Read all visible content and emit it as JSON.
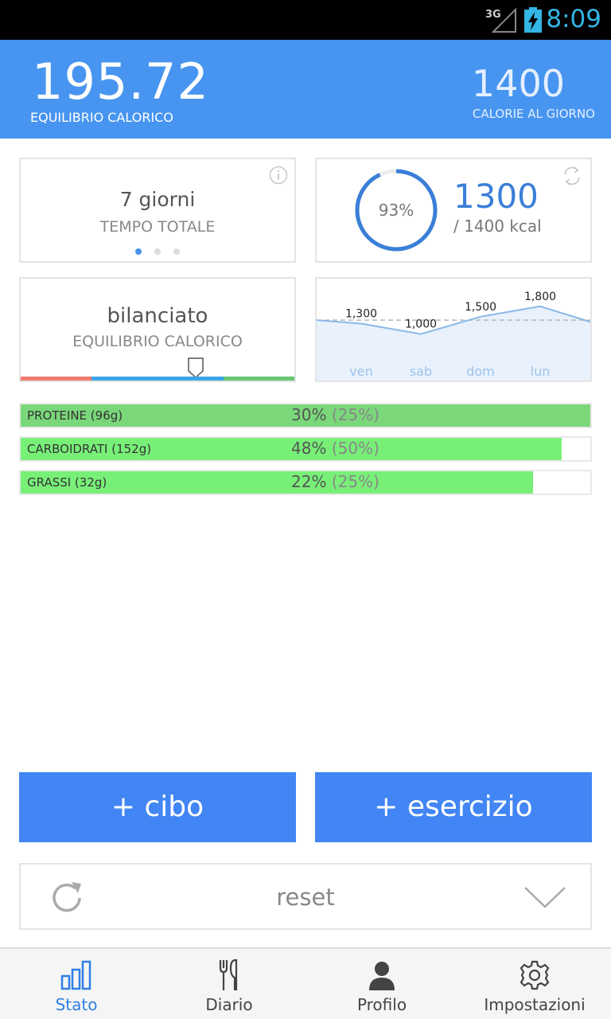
{
  "status_bar": {
    "network": "3G",
    "time": "8:09"
  },
  "header": {
    "balance": "195.72",
    "balance_label": "EQUILIBRIO CALORICO",
    "daily_goal": "1400",
    "daily_goal_label": "CALORIE AL GIORNO"
  },
  "card_days": {
    "value": "7 giorni",
    "label": "TEMPO TOTALE",
    "page": 1,
    "pages": 3
  },
  "card_progress": {
    "percent_text": "93%",
    "percent": 0.93,
    "value": "1300",
    "subtitle": "/ 1400 kcal"
  },
  "card_balance": {
    "value": "bilanciato",
    "label": "EQUILIBRIO CALORICO",
    "marker_position": 0.64
  },
  "chart_data": {
    "type": "area",
    "categories": [
      "ven",
      "sab",
      "dom",
      "lun"
    ],
    "values": [
      1300,
      1000,
      1500,
      1800
    ],
    "labels": [
      "1,300",
      "1,000",
      "1,500",
      "1,800"
    ],
    "reference_line": 1400,
    "ylim": [
      300,
      2600
    ],
    "grid": false,
    "colors": {
      "line": "#8ab8e6",
      "fill": "#e8f1fc",
      "ref": "#b8b8b8",
      "axis_text": "#9ec3ea"
    }
  },
  "macros": [
    {
      "label": "PROTEINE (96g)",
      "percent": "30%",
      "target": "(25%)",
      "fill": 1.0,
      "color": "#7ad87a"
    },
    {
      "label": "CARBOIDRATI (152g)",
      "percent": "48%",
      "target": "(50%)",
      "fill": 0.95,
      "color": "#78f078"
    },
    {
      "label": "GRASSI (32g)",
      "percent": "22%",
      "target": "(25%)",
      "fill": 0.9,
      "color": "#78f078"
    }
  ],
  "actions": {
    "add_food": "+ cibo",
    "add_exercise": "+ esercizio",
    "reset": "reset"
  },
  "nav": [
    {
      "label": "Stato",
      "icon": "bar-chart-icon",
      "active": true
    },
    {
      "label": "Diario",
      "icon": "fork-knife-icon",
      "active": false
    },
    {
      "label": "Profilo",
      "icon": "person-icon",
      "active": false
    },
    {
      "label": "Impostazioni",
      "icon": "gear-icon",
      "active": false
    }
  ],
  "colors": {
    "accent": "#4795f0",
    "button": "#4285f4",
    "nav_active": "#2f7fe6"
  }
}
